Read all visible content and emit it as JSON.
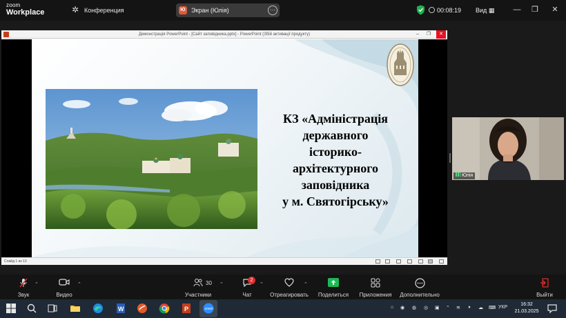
{
  "zoom_header": {
    "logo_line1": "zoom",
    "logo_line2": "Workplace",
    "conference_label": "Конференция",
    "screen_share_avatar": "Ю",
    "screen_share_label": "Экран (Юлія)",
    "timer": "00:08:19",
    "view_label": "Вид"
  },
  "powerpoint": {
    "window_title": "Демонстрація PowerPoint - [Сайт заповідника.pptx] - PowerPoint (Збій активації продукту)",
    "status_left": "Слайд 1 из 13",
    "slide_title_lines": [
      "КЗ «Адміністрація",
      "державного",
      "історико-",
      "архітектурного",
      "заповідника",
      "у м. Святогірську»"
    ]
  },
  "participant": {
    "name": "Юлія"
  },
  "toolbar": {
    "audio_label": "Звук",
    "video_label": "Видео",
    "participants_label": "Участники",
    "participants_count": "30",
    "chat_label": "Чат",
    "chat_badge": "2",
    "react_label": "Отреагировать",
    "share_label": "Поделиться",
    "apps_label": "Приложения",
    "more_label": "Дополнительно",
    "leave_label": "Выйти"
  },
  "taskbar": {
    "lang": "УКР",
    "time": "16:32",
    "date": "21.03.2025"
  },
  "icons": {
    "gear": "gear-icon",
    "shield": "shield-check-icon",
    "mic_muted": "mic-muted-icon",
    "camera": "camera-icon",
    "participants": "participants-icon",
    "chat": "chat-icon",
    "react": "heart-icon",
    "share": "share-screen-icon",
    "apps": "apps-icon",
    "more": "more-icon",
    "leave": "leave-icon"
  },
  "colors": {
    "zoom_bg": "#141414",
    "share_green": "#1db954",
    "leave_red": "#e02e2e",
    "shield_green": "#1fb150"
  }
}
